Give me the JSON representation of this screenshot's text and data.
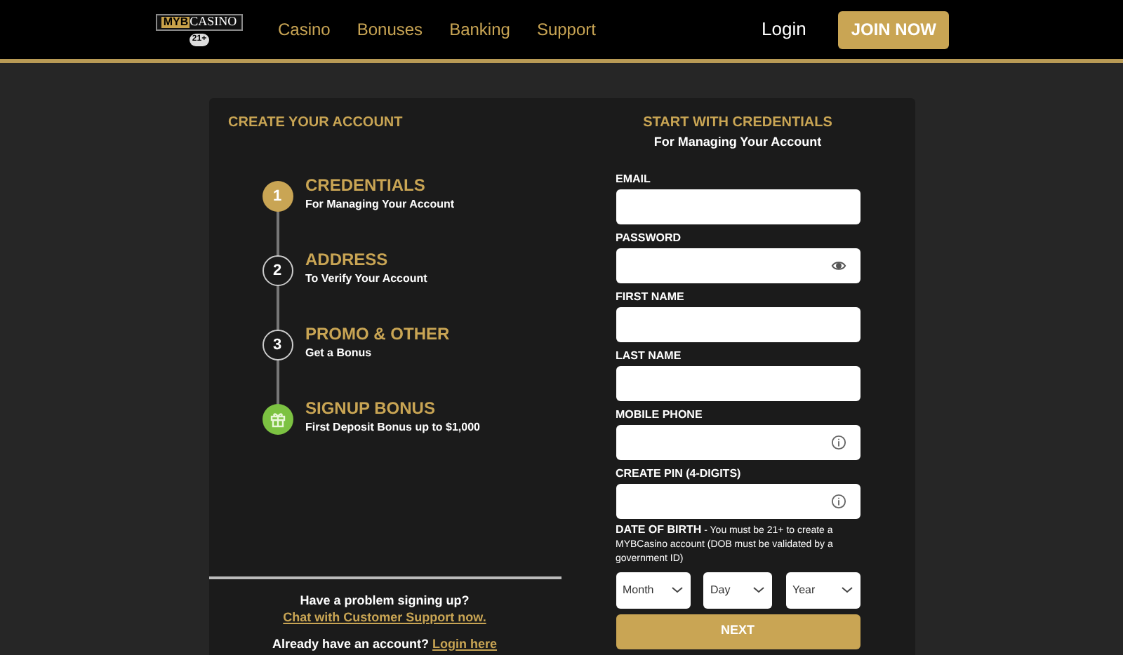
{
  "header": {
    "logo": {
      "brand_mark": "MYB",
      "brand_name": "CASINO",
      "age_badge": "21+"
    },
    "nav": [
      "Casino",
      "Bonuses",
      "Banking",
      "Support"
    ],
    "login": "Login",
    "join": "JOIN NOW"
  },
  "steps_panel": {
    "title": "CREATE YOUR ACCOUNT",
    "steps": [
      {
        "kind": "number",
        "marker": "1",
        "selected": true,
        "title": "CREDENTIALS",
        "subtitle": "For Managing Your Account"
      },
      {
        "kind": "number",
        "marker": "2",
        "selected": false,
        "title": "ADDRESS",
        "subtitle": "To Verify Your Account"
      },
      {
        "kind": "number",
        "marker": "3",
        "selected": false,
        "title": "PROMO & OTHER",
        "subtitle": "Get a Bonus"
      },
      {
        "kind": "gift",
        "selected": false,
        "title": "SIGNUP BONUS",
        "subtitle": "First Deposit Bonus up to $1,000"
      }
    ],
    "help": {
      "text": "Have a problem signing up?",
      "link": "Chat with Customer Support now."
    },
    "login_prompt": {
      "text": "Already have an account?",
      "link": "Login here"
    }
  },
  "form": {
    "title": "START WITH CREDENTIALS",
    "subtitle": "For Managing Your Account",
    "fields": [
      {
        "label": "EMAIL",
        "kind": "text"
      },
      {
        "label": "PASSWORD",
        "kind": "password"
      },
      {
        "label": "FIRST NAME",
        "kind": "text"
      },
      {
        "label": "LAST NAME",
        "kind": "text"
      },
      {
        "label": "MOBILE PHONE",
        "kind": "info"
      },
      {
        "label": "CREATE PIN (4-DIGITS)",
        "kind": "info"
      }
    ],
    "dob_note": "**DATE OF BIRTH** - You must be 21+ to create a MYBCasino account (DOB must be validated by a government ID)",
    "dob_selects": [
      "Month",
      "Day",
      "Year"
    ],
    "submit": "NEXT"
  }
}
